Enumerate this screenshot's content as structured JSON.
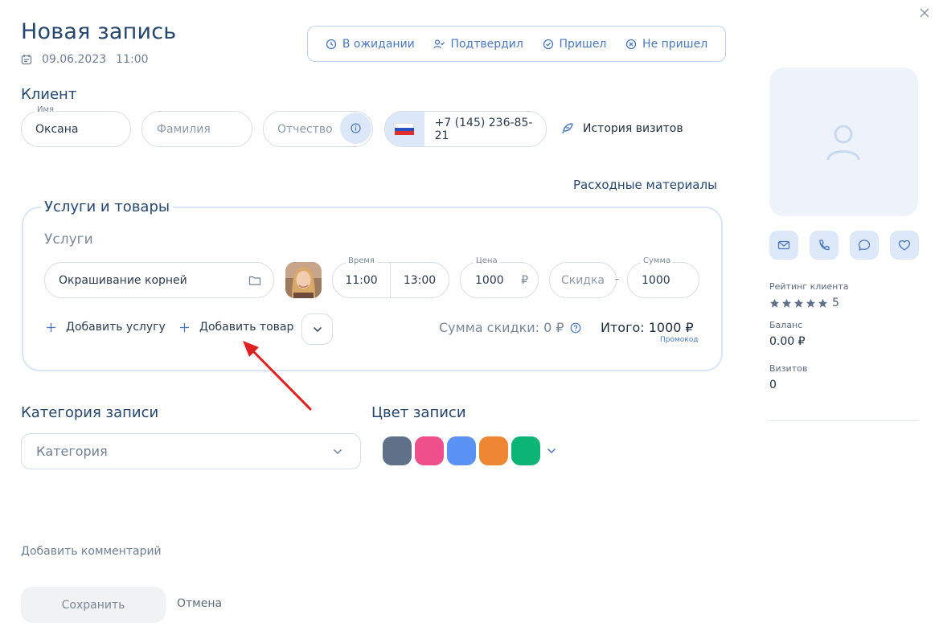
{
  "header": {
    "title": "Новая запись",
    "date": "09.06.2023",
    "time": "11:00"
  },
  "statuses": [
    {
      "label": "В ожидании",
      "icon": "clock-icon"
    },
    {
      "label": "Подтвердил",
      "icon": "user-check-icon"
    },
    {
      "label": "Пришел",
      "icon": "check-circle-icon"
    },
    {
      "label": "Не пришел",
      "icon": "x-circle-icon"
    }
  ],
  "client": {
    "section_title": "Клиент",
    "first_name_label": "Имя",
    "first_name_value": "Оксана",
    "last_name_placeholder": "Фамилия",
    "patronymic_placeholder": "Отчество",
    "phone": "+7 (145) 236-85-21",
    "history_label": "История визитов"
  },
  "consumables_label": "Расходные материалы",
  "services": {
    "card_title": "Услуги и товары",
    "subtitle": "Услуги",
    "service_name": "Окрашивание корней",
    "time_label": "Время",
    "time_start": "11:00",
    "time_end": "13:00",
    "price_label": "Цена",
    "price_value": "1000",
    "currency": "₽",
    "discount_placeholder": "Скидка",
    "sum_label": "Сумма",
    "sum_value": "1000",
    "add_service": "Добавить услугу",
    "add_product": "Добавить товар",
    "discount_sum": "Сумма скидки: 0 ₽",
    "total": "Итого: 1000 ₽",
    "promo": "Промокод"
  },
  "category": {
    "title": "Категория записи",
    "placeholder": "Категория"
  },
  "color": {
    "title": "Цвет записи",
    "swatches": [
      "#5f7089",
      "#ef4f8a",
      "#5b93f5",
      "#ee8634",
      "#0cb575"
    ]
  },
  "comment_label": "Добавить комментарий",
  "buttons": {
    "save": "Сохранить",
    "cancel": "Отмена"
  },
  "sidebar": {
    "rating_label": "Рейтинг клиента",
    "rating_value": "5",
    "rating_stars": 5,
    "balance_label": "Баланс",
    "balance_value": "0.00 ₽",
    "visits_label": "Визитов",
    "visits_value": "0"
  },
  "colors": {
    "accent": "#4a78c1",
    "title": "#25466e",
    "annotation_arrow": "#e02020"
  }
}
